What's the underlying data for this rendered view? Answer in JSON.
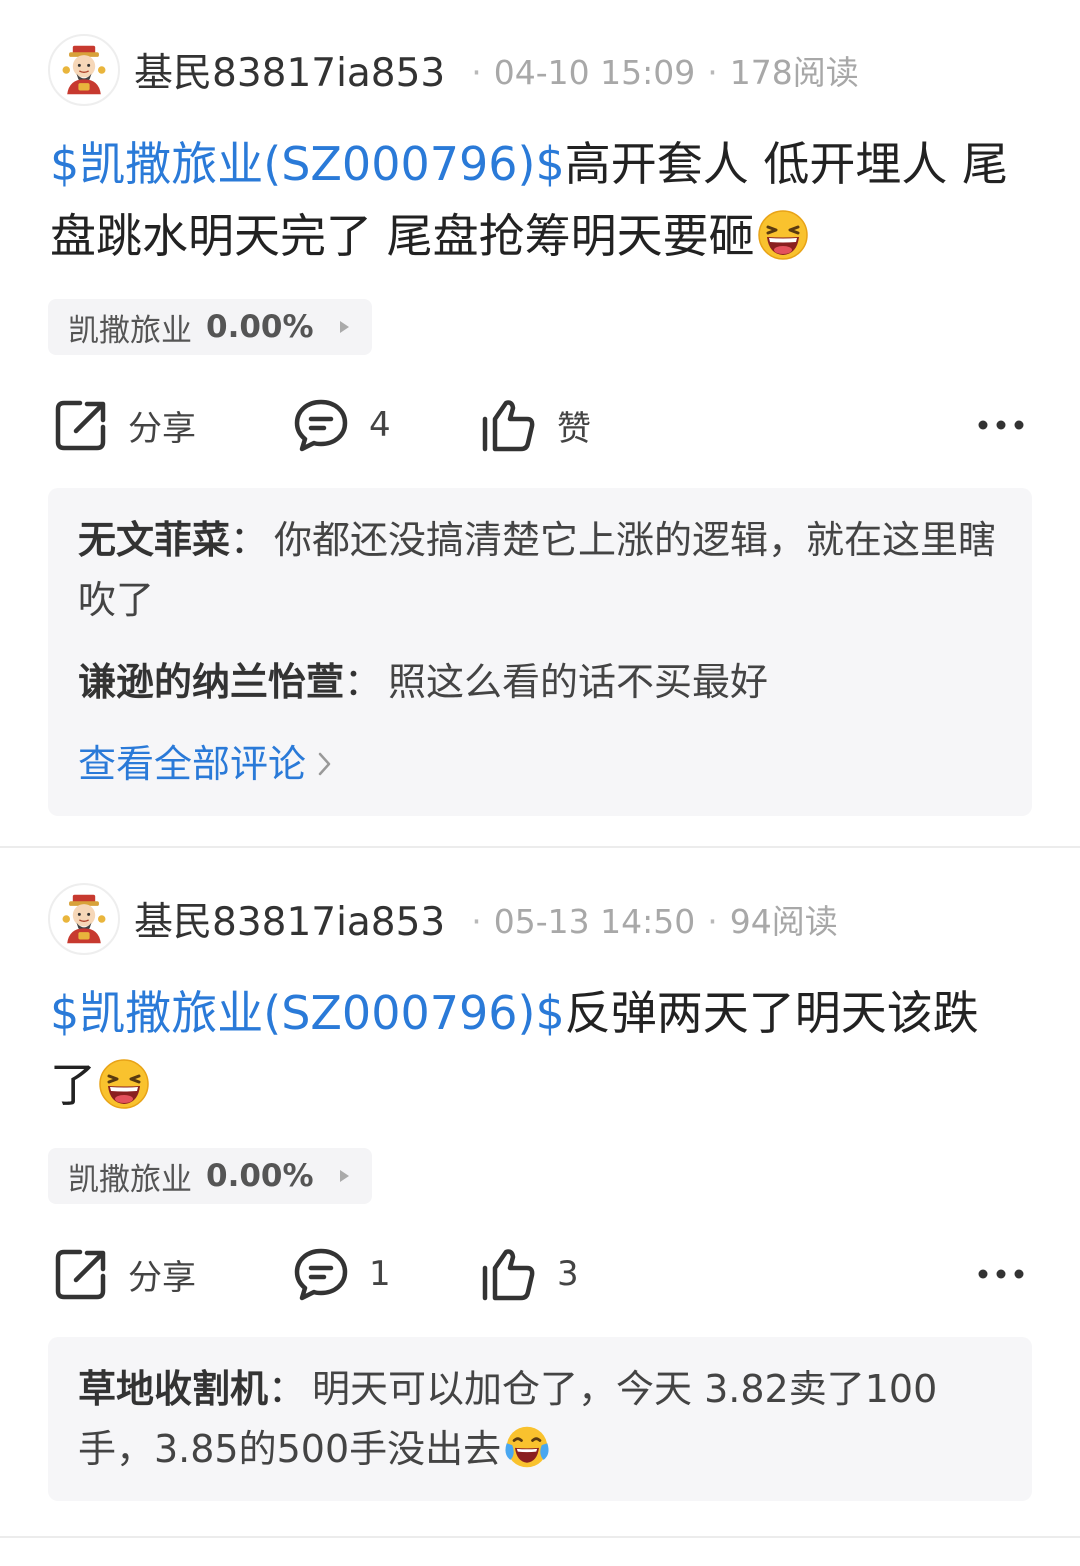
{
  "posts": [
    {
      "author": "基民83817ia853",
      "date": "04-10 15:09",
      "reads": "178阅读",
      "stock_tag": "$凯撒旅业(SZ000796)$",
      "text": "高开套人  低开埋人  尾盘跳水明天完了  尾盘抢筹明天要砸",
      "emoji": "laughing-face-emoji",
      "chip_name": "凯撒旅业",
      "chip_pct": "0.00%",
      "share_label": "分享",
      "comment_count": "4",
      "like_label": "赞",
      "comments": [
        {
          "author": "无文菲菜",
          "sep": "：",
          "text": "你都还没搞清楚它上涨的逻辑，就在这里瞎吹了"
        },
        {
          "author": "谦逊的纳兰怡萱",
          "sep": "：",
          "text": "照这么看的话不买最好"
        }
      ],
      "view_all": "查看全部评论"
    },
    {
      "author": "基民83817ia853",
      "date": "05-13 14:50",
      "reads": "94阅读",
      "stock_tag": "$凯撒旅业(SZ000796)$",
      "text": "反弹两天了明天该跌了",
      "emoji": "laughing-face-emoji",
      "chip_name": "凯撒旅业",
      "chip_pct": "0.00%",
      "share_label": "分享",
      "comment_count": "1",
      "like_label": "3",
      "comments": [
        {
          "author": "草地收割机",
          "sep": "：",
          "text": "明天可以加仓了，今天 3.82卖了100手，3.85的500手没出去"
        }
      ]
    }
  ],
  "colors": {
    "link": "#2a7ad8",
    "divider": "#ececec",
    "comment_bg": "#f6f6f8",
    "chip_bg": "#f4f4f6",
    "meta": "#a8a8a8"
  },
  "icons": [
    "avatar-god-of-wealth-icon",
    "share-icon",
    "comment-icon",
    "thumbs-up-icon",
    "more-icon",
    "chevron-right-icon",
    "laughing-face-emoji",
    "crying-laughing-emoji"
  ]
}
